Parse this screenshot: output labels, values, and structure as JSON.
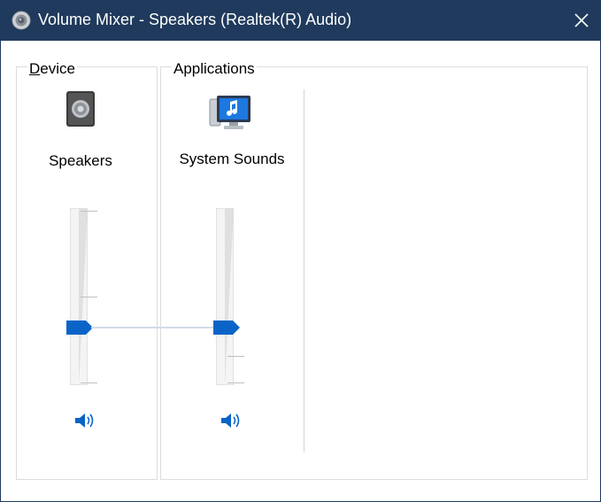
{
  "window": {
    "title": "Volume Mixer - Speakers (Realtek(R) Audio)",
    "title_icon": "speaker-icon",
    "close_icon": "close-icon",
    "colors": {
      "titlebar": "#1f3a5c",
      "accent": "#0a64c8"
    }
  },
  "device": {
    "group_label_first": "D",
    "group_label_rest": "evice",
    "name": "Speakers",
    "icon": "speaker-device-icon",
    "volume_percent": 32,
    "mute_icon": "speaker-volume-icon"
  },
  "applications": {
    "group_label": "Applications",
    "items": [
      {
        "name": "System Sounds",
        "icon": "system-sounds-icon",
        "volume_percent": 32,
        "mute_icon": "speaker-volume-icon"
      }
    ]
  }
}
